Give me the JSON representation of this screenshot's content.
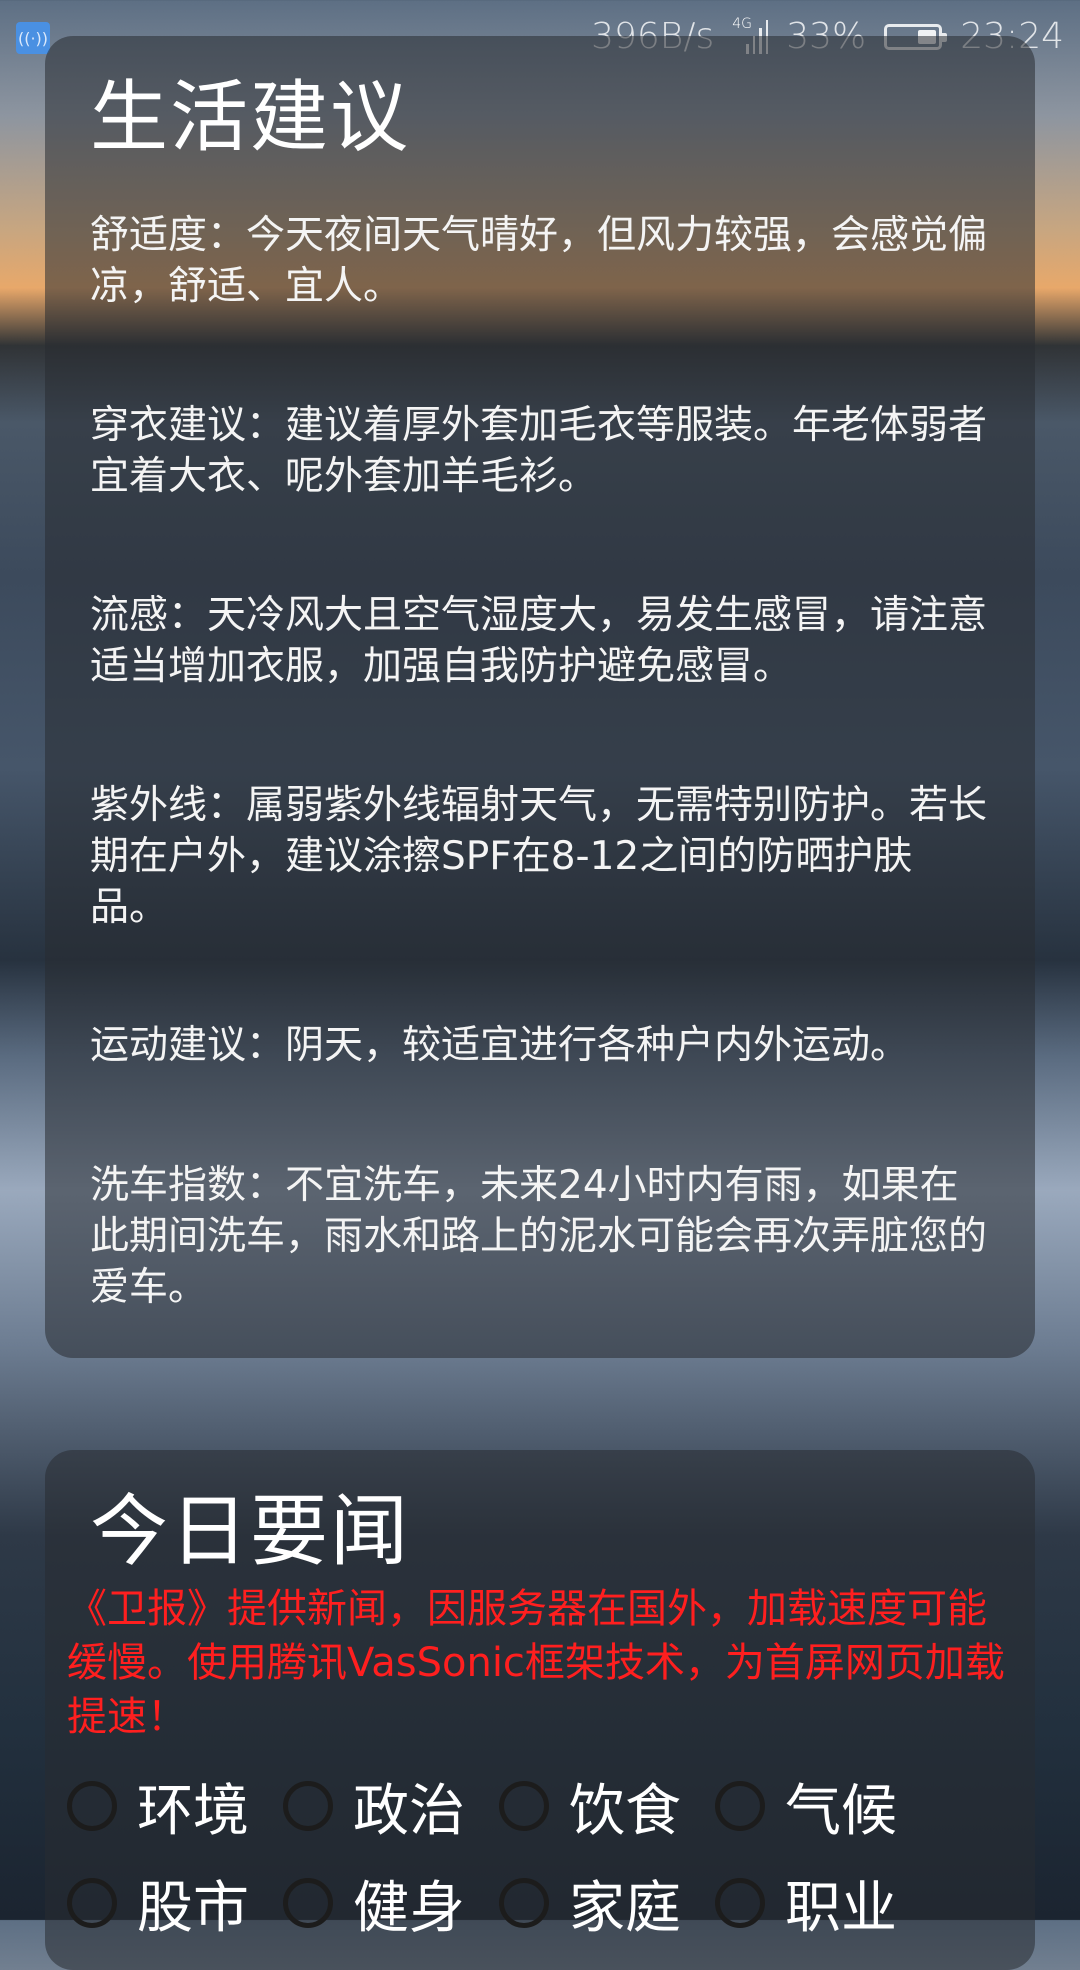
{
  "status_bar": {
    "notification_icon": "hotspot-icon",
    "network_speed": "396B/s",
    "network_type": "4G",
    "battery_percent": "33%",
    "battery_level": 0.33,
    "time": "23:24"
  },
  "life_advice": {
    "title": "生活建议",
    "items": [
      "舒适度：今天夜间天气晴好，但风力较强，会感觉偏凉，舒适、宜人。",
      "穿衣建议：建议着厚外套加毛衣等服装。年老体弱者宜着大衣、呢外套加羊毛衫。",
      "流感：天冷风大且空气湿度大，易发生感冒，请注意适当增加衣服，加强自我防护避免感冒。",
      "紫外线：属弱紫外线辐射天气，无需特别防护。若长期在户外，建议涂擦SPF在8-12之间的防晒护肤品。",
      "运动建议：阴天，较适宜进行各种户内外运动。",
      "洗车指数：不宜洗车，未来24小时内有雨，如果在此期间洗车，雨水和路上的泥水可能会再次弄脏您的爱车。"
    ]
  },
  "news": {
    "title": "今日要闻",
    "notice": "《卫报》提供新闻，因服务器在国外，加载速度可能缓慢。使用腾讯VasSonic框架技术，为首屏网页加载提速！",
    "notice_color": "#ff1f1f",
    "categories": [
      "环境",
      "政治",
      "饮食",
      "气候",
      "股市",
      "健身",
      "家庭",
      "职业"
    ]
  }
}
